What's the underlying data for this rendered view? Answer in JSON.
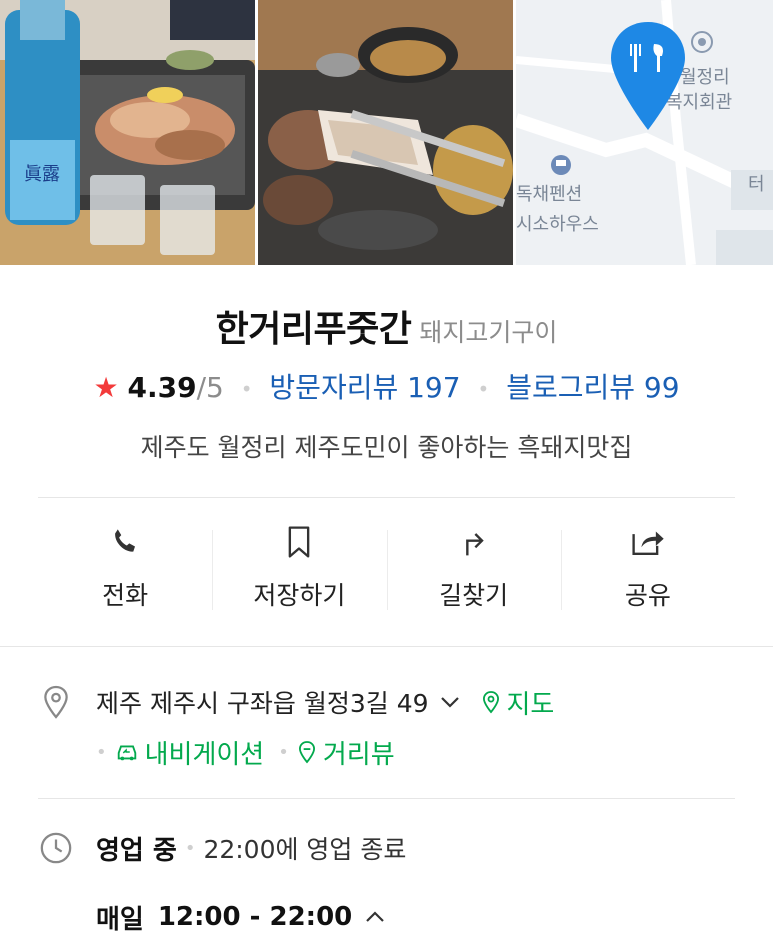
{
  "place": {
    "name": "한거리푸줏간",
    "category": "돼지고기구이",
    "rating": "4.39",
    "rating_max": "/5",
    "visitor_reviews": "방문자리뷰 197",
    "blog_reviews": "블로그리뷰 99",
    "description": "제주도 월정리 제주도민이 좋아하는 흑돼지맛집"
  },
  "photos": {
    "soju_label": "眞露",
    "map_labels": [
      "월정리",
      "복지회관",
      "독채펜션",
      "시소하우스",
      "터"
    ]
  },
  "actions": [
    {
      "label": "전화",
      "icon": "phone-icon"
    },
    {
      "label": "저장하기",
      "icon": "bookmark-icon"
    },
    {
      "label": "길찾기",
      "icon": "directions-icon"
    },
    {
      "label": "공유",
      "icon": "share-icon"
    }
  ],
  "address": {
    "text": "제주 제주시 구좌읍 월정3길 49",
    "map_link": "지도",
    "navigation_link": "내비게이션",
    "streetview_link": "거리뷰"
  },
  "hours": {
    "status": "영업 중",
    "closing": "22:00에 영업 종료",
    "day": "매일",
    "range": "12:00 - 22:00"
  },
  "colors": {
    "accent_green": "#03a94d",
    "link_blue": "#1a5fb4",
    "star_red": "#f33a3a",
    "map_pin_blue": "#1e88e5"
  }
}
